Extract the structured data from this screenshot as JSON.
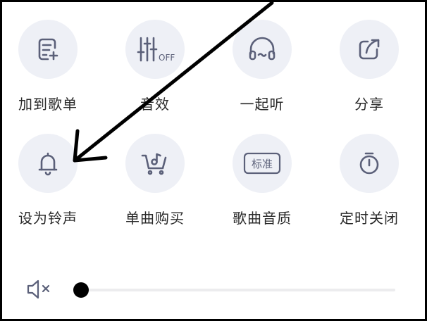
{
  "actions": [
    {
      "label": "加到歌单",
      "icon": "add-to-playlist-icon"
    },
    {
      "label": "音效",
      "icon": "sound-effects-icon",
      "badge": "OFF"
    },
    {
      "label": "一起听",
      "icon": "listen-together-icon"
    },
    {
      "label": "分享",
      "icon": "share-icon"
    },
    {
      "label": "设为铃声",
      "icon": "bell-icon"
    },
    {
      "label": "单曲购买",
      "icon": "buy-cart-icon"
    },
    {
      "label": "歌曲音质",
      "icon": "quality-icon",
      "badge": "标准"
    },
    {
      "label": "定时关闭",
      "icon": "timer-icon"
    }
  ],
  "volume": {
    "level": 0.0,
    "muted": true
  },
  "colors": {
    "circle": "#eef0f6",
    "icon": "#5b6079",
    "text": "#2a2a2a"
  }
}
